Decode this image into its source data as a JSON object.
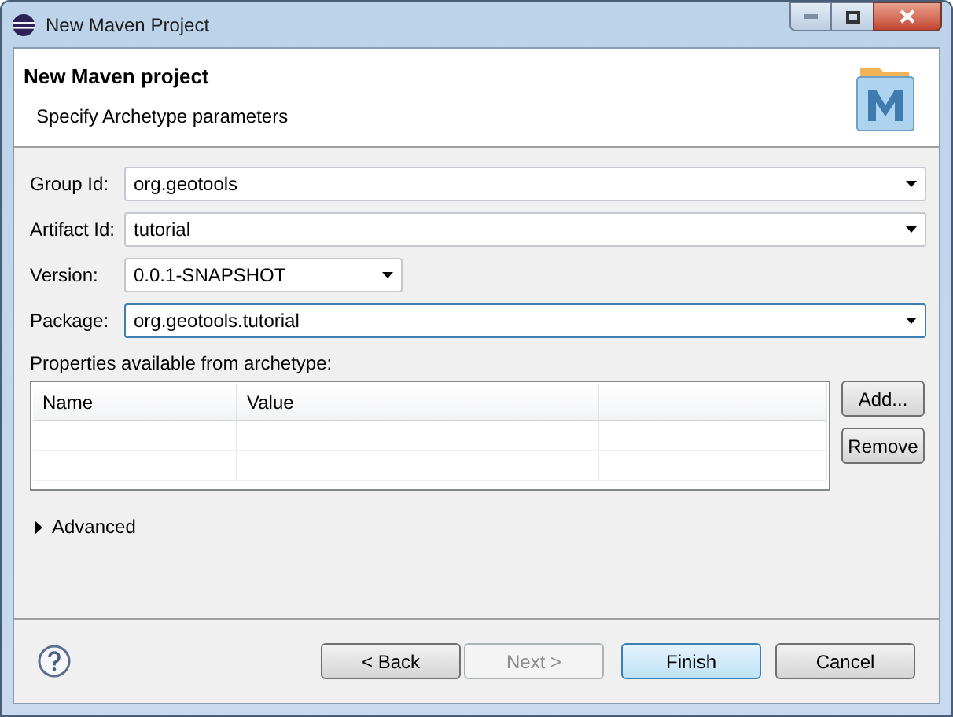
{
  "window": {
    "title": "New Maven Project"
  },
  "header": {
    "title": "New Maven project",
    "subtitle": "Specify Archetype parameters"
  },
  "fields": [
    {
      "label": "Group Id:",
      "value": "org.geotools",
      "wide": true,
      "focused": false
    },
    {
      "label": "Artifact Id:",
      "value": "tutorial",
      "wide": true,
      "focused": false
    },
    {
      "label": "Version:",
      "value": "0.0.1-SNAPSHOT",
      "wide": false,
      "focused": false
    },
    {
      "label": "Package:",
      "value": "org.geotools.tutorial",
      "wide": true,
      "focused": true
    }
  ],
  "properties": {
    "label": "Properties available from archetype:",
    "columns": [
      "Name",
      "Value"
    ],
    "buttons": [
      "Add...",
      "Remove"
    ]
  },
  "advanced": {
    "label": "Advanced",
    "expanded": false
  },
  "buttons": [
    {
      "label": "< Back",
      "disabled": false,
      "default": false
    },
    {
      "label": "Next >",
      "disabled": true,
      "default": false
    },
    {
      "label": "Finish",
      "disabled": false,
      "default": true
    },
    {
      "label": "Cancel",
      "disabled": false,
      "default": false
    }
  ]
}
